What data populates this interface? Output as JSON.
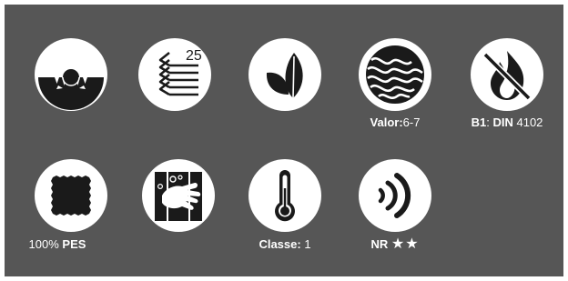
{
  "colors": {
    "panel": "#565656",
    "icon_fill": "#ffffff",
    "icon_mark": "#1a1a1a"
  },
  "icons": [
    {
      "name": "sun-blocked-icon"
    },
    {
      "name": "fold-layers-icon",
      "number": "25"
    },
    {
      "name": "leaves-icon"
    },
    {
      "name": "waves-icon",
      "caption": {
        "label": "Valor:",
        "value": "6-7"
      }
    },
    {
      "name": "no-fire-icon",
      "caption": {
        "label_a": "B1",
        "sep": ":",
        "label_b": "DIN",
        "value": "4102"
      }
    },
    {
      "name": "fabric-swatch-icon",
      "caption": {
        "value": "100%",
        "label": "PES"
      }
    },
    {
      "name": "hand-washing-icon"
    },
    {
      "name": "thermometer-icon",
      "caption": {
        "label": "Classe:",
        "value": "1"
      }
    },
    {
      "name": "sound-waves-icon",
      "caption": {
        "label": "NR",
        "stars": "★★"
      }
    }
  ]
}
